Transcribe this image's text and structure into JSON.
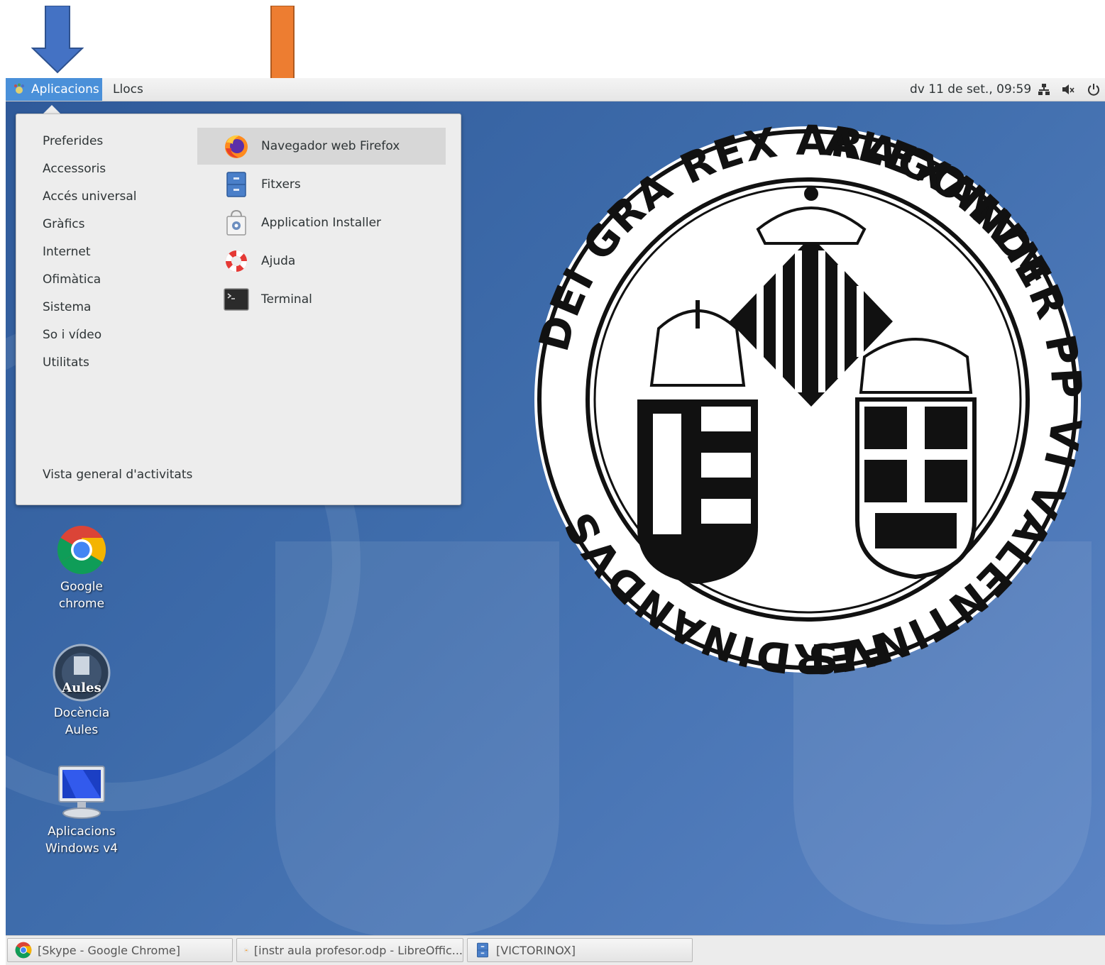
{
  "colors": {
    "blue_arrow": "#4472c4",
    "orange_arrow": "#ed7d31",
    "accent": "#4a90d9"
  },
  "top_panel": {
    "applications_label": "Aplicacions",
    "places_label": "Llocs",
    "clock": "dv 11 de set., 09:59",
    "tray_icons": [
      "network-icon",
      "volume-muted-icon",
      "power-icon"
    ]
  },
  "apps_menu": {
    "categories": [
      "Preferides",
      "Accessoris",
      "Accés universal",
      "Gràfics",
      "Internet",
      "Ofimàtica",
      "Sistema",
      "So i vídeo",
      "Utilitats"
    ],
    "apps": [
      {
        "label": "Navegador web Firefox",
        "icon": "firefox-icon"
      },
      {
        "label": "Fitxers",
        "icon": "files-icon"
      },
      {
        "label": "Application Installer",
        "icon": "app-installer-icon"
      },
      {
        "label": "Ajuda",
        "icon": "help-icon"
      },
      {
        "label": "Terminal",
        "icon": "terminal-icon"
      }
    ],
    "activities_overview": "Vista general d'activitats"
  },
  "desktop": {
    "icons": [
      {
        "line1": "Google",
        "line2": "chrome",
        "icon": "chrome-icon"
      },
      {
        "line1": "Docència",
        "line2": "Aules",
        "icon": "aules-icon",
        "badge": "Aules"
      },
      {
        "line1": "Aplicacions",
        "line2": "Windows v4",
        "icon": "monitor-icon"
      }
    ],
    "seal": {
      "top_text": "ALEXANDER PP VI VALENTINVS",
      "left_text": "DEI GRA REX ARAGONVM",
      "bottom_text": "FERDINANDVS"
    }
  },
  "taskbar": {
    "tasks": [
      {
        "label": "[Skype - Google Chrome]",
        "icon": "chrome-icon"
      },
      {
        "label": "[instr aula profesor.odp - LibreOffic...",
        "icon": "impress-icon"
      },
      {
        "label": "[VICTORINOX]",
        "icon": "files-icon"
      }
    ]
  }
}
